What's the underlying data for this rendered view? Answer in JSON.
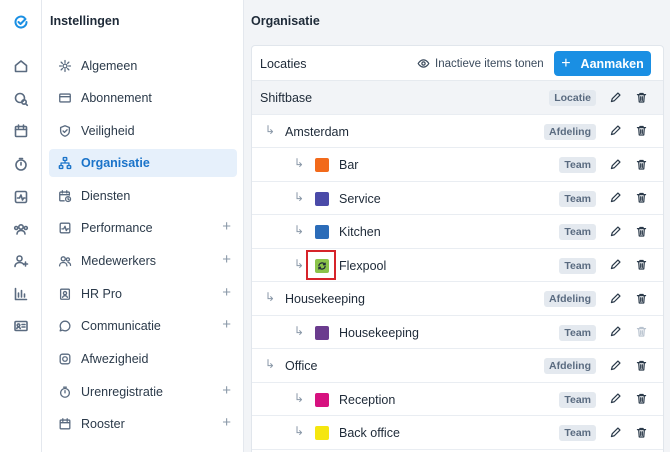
{
  "rail": {
    "icons": [
      "logo-check-icon",
      "home-icon",
      "search-location-icon",
      "calendar-icon",
      "stopwatch-icon",
      "activity-icon",
      "team-icon",
      "add-user-icon",
      "bar-chart-icon",
      "id-card-icon"
    ]
  },
  "sidebar": {
    "title": "Instellingen",
    "items": [
      {
        "label": "Algemeen",
        "icon": "gear-icon",
        "expandable": false
      },
      {
        "label": "Abonnement",
        "icon": "credit-card-icon",
        "expandable": false
      },
      {
        "label": "Veiligheid",
        "icon": "shield-check-icon",
        "expandable": false
      },
      {
        "label": "Organisatie",
        "icon": "org-chart-icon",
        "expandable": false,
        "active": true
      },
      {
        "label": "Diensten",
        "icon": "calendar-clock-icon",
        "expandable": false
      },
      {
        "label": "Performance",
        "icon": "activity-icon",
        "expandable": true
      },
      {
        "label": "Medewerkers",
        "icon": "users-icon",
        "expandable": true
      },
      {
        "label": "HR Pro",
        "icon": "id-badge-icon",
        "expandable": true
      },
      {
        "label": "Communicatie",
        "icon": "chat-icon",
        "expandable": true
      },
      {
        "label": "Afwezigheid",
        "icon": "absence-icon",
        "expandable": false
      },
      {
        "label": "Urenregistratie",
        "icon": "stopwatch-icon",
        "expandable": true
      },
      {
        "label": "Rooster",
        "icon": "calendar-icon",
        "expandable": true
      }
    ],
    "plus_label": "+"
  },
  "main": {
    "title": "Organisatie",
    "panel": {
      "title": "Locaties",
      "inactive_toggle": "Inactieve items tonen",
      "create_button": "Aanmaken",
      "create_plus": "+"
    },
    "rows": [
      {
        "name": "Shiftbase",
        "level": 0,
        "badge": "Locatie",
        "color": null
      },
      {
        "name": "Amsterdam",
        "level": 1,
        "badge": "Afdeling",
        "color": null
      },
      {
        "name": "Bar",
        "level": 2,
        "badge": "Team",
        "color": "#f26a1b"
      },
      {
        "name": "Service",
        "level": 2,
        "badge": "Team",
        "color": "#4a4aa8"
      },
      {
        "name": "Kitchen",
        "level": 2,
        "badge": "Team",
        "color": "#2b6cb8"
      },
      {
        "name": "Flexpool",
        "level": 2,
        "badge": "Team",
        "color": "#8bc34a",
        "sync": true
      },
      {
        "name": "Housekeeping",
        "level": 1,
        "badge": "Afdeling",
        "color": null
      },
      {
        "name": "Housekeeping",
        "level": 2,
        "badge": "Team",
        "color": "#6b3c8e",
        "delete_disabled": true
      },
      {
        "name": "Office",
        "level": 1,
        "badge": "Afdeling",
        "color": null
      },
      {
        "name": "Reception",
        "level": 2,
        "badge": "Team",
        "color": "#d6117f"
      },
      {
        "name": "Back office",
        "level": 2,
        "badge": "Team",
        "color": "#f5e60f"
      }
    ],
    "arrow_glyph": "↳",
    "highlight_color": "#d6242a"
  },
  "colors": {
    "accent": "#1a8fe3",
    "active_nav_bg": "#e6f0fb",
    "active_nav_text": "#1a73c9"
  }
}
